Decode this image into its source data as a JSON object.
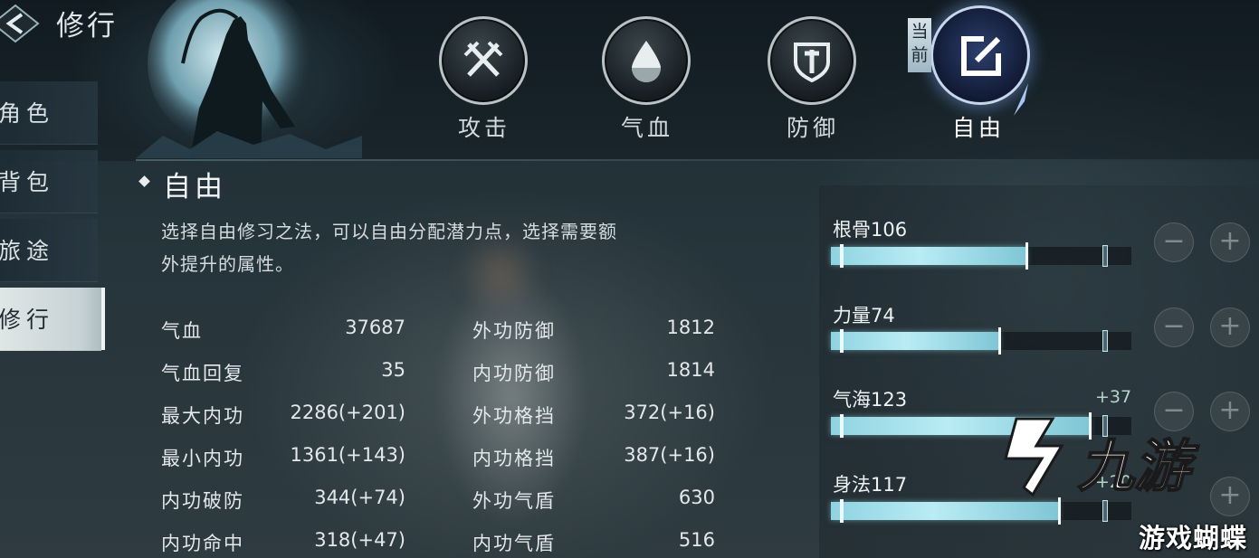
{
  "header": {
    "title": "修行",
    "back_icon": "back-arrow-diamond-icon"
  },
  "side_nav": {
    "items": [
      {
        "label": "角色",
        "active": false
      },
      {
        "label": "背包",
        "active": false
      },
      {
        "label": "旅途",
        "active": false
      },
      {
        "label": "修行",
        "active": true
      }
    ]
  },
  "tabs": [
    {
      "label": "攻击",
      "icon": "crossed-swords-icon",
      "active": false
    },
    {
      "label": "气血",
      "icon": "blood-drop-icon",
      "active": false
    },
    {
      "label": "防御",
      "icon": "shield-icon",
      "active": false
    },
    {
      "label": "自由",
      "icon": "edit-square-icon",
      "active": true
    }
  ],
  "current_badge": "当前",
  "section": {
    "title": "自由",
    "description_line1": "选择自由修习之法，可以自由分配潜力点，选择需要额",
    "description_line2": "外提升的属性。"
  },
  "stats": [
    {
      "name1": "气血",
      "value1": "37687",
      "name2": "外功防御",
      "value2": "1812"
    },
    {
      "name1": "气血回复",
      "value1": "35",
      "name2": "内功防御",
      "value2": "1814"
    },
    {
      "name1": "最大内功",
      "value1": "2286(+201)",
      "name2": "外功格挡",
      "value2": "372(+16)"
    },
    {
      "name1": "最小内功",
      "value1": "1361(+143)",
      "name2": "内功格挡",
      "value2": "387(+16)"
    },
    {
      "name1": "内功破防",
      "value1": "344(+74)",
      "name2": "外功气盾",
      "value2": "630"
    },
    {
      "name1": "内功命中",
      "value1": "318(+47)",
      "name2": "内功气盾",
      "value2": "516"
    }
  ],
  "attributes": [
    {
      "label": "根骨106",
      "fill": 0.65,
      "bonus": ""
    },
    {
      "label": "力量74",
      "fill": 0.56,
      "bonus": ""
    },
    {
      "label": "气海123",
      "fill": 0.86,
      "bonus": "+37"
    },
    {
      "label": "身法117",
      "fill": 0.76,
      "bonus": "+20"
    }
  ],
  "buttons": {
    "minus": "−",
    "plus": "+"
  },
  "watermark": {
    "brand": "九游",
    "sub": "游戏蝴蝶"
  },
  "colors": {
    "bar_fill": "#8fd3e1",
    "active_tab_ring": "#c8d6ec",
    "background": "#26343b"
  }
}
